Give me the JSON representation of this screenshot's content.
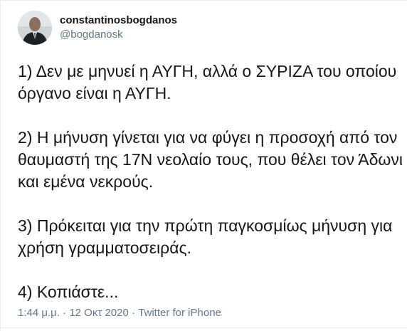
{
  "user": {
    "display_name": "constantinosbogdanos",
    "handle": "@bogdanosk"
  },
  "tweet": {
    "lines": [
      "1) Δεν με μηνυεί η ΑΥΓΗ, αλλά ο ΣΥΡΙΖΑ του οποίου",
      "όργανο είναι η ΑΥΓΗ.",
      "",
      "2) Η μήνυση γίνεται για να φύγει η προσοχή από τον",
      "θαυμαστή της 17Ν νεολαίο τους, που θέλει τον Άδωνι",
      "και εμένα νεκρούς.",
      "",
      "3) Πρόκειται για την πρώτη παγκοσμίως μήνυση για",
      "χρήση γραμματοσειράς.",
      "",
      "4) Κοπιάστε..."
    ]
  },
  "meta": {
    "time": "1:44 μ.μ.",
    "separator1": "·",
    "date": "12 Οκτ 2020",
    "separator2": "·",
    "source": "Twitter for iPhone"
  }
}
